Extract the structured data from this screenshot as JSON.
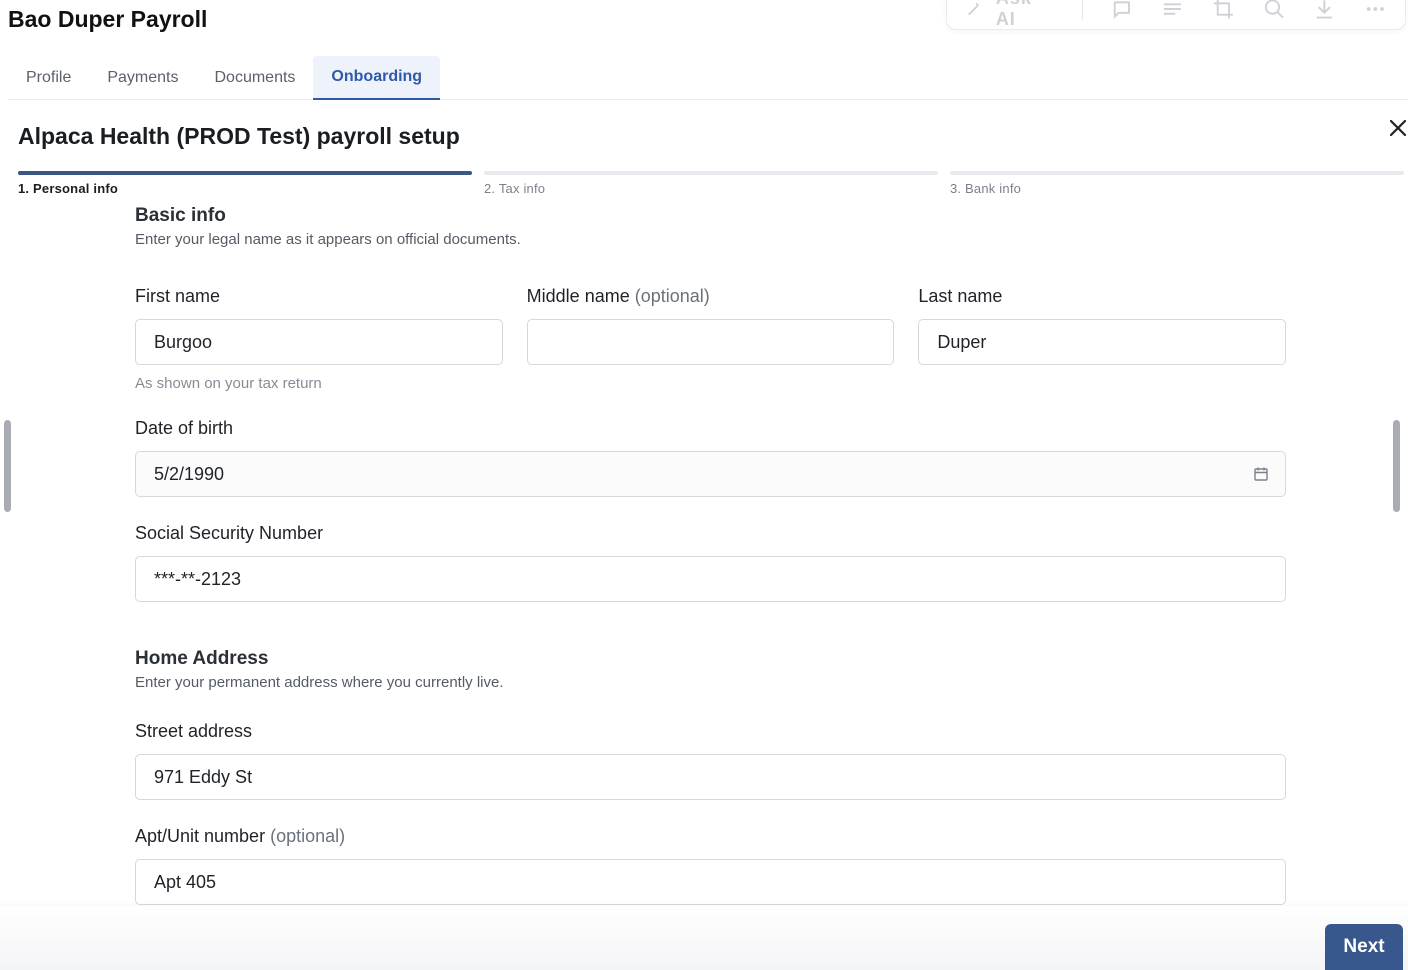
{
  "app": {
    "title": "Bao Duper Payroll"
  },
  "toolbar": {
    "ask_label": "Ask AI",
    "icons": [
      "sparkle-icon",
      "comment-icon",
      "lines-icon",
      "crop-icon",
      "zoom-icon",
      "download-icon",
      "more-icon"
    ]
  },
  "tabs": [
    {
      "label": "Profile",
      "active": false
    },
    {
      "label": "Payments",
      "active": false
    },
    {
      "label": "Documents",
      "active": false
    },
    {
      "label": "Onboarding",
      "active": true
    }
  ],
  "setup": {
    "title": "Alpaca Health (PROD Test) payroll setup",
    "steps": [
      {
        "label": "1. Personal info",
        "active": true
      },
      {
        "label": "2. Tax info",
        "active": false
      },
      {
        "label": "3. Bank info",
        "active": false
      }
    ]
  },
  "basic_info": {
    "title": "Basic info",
    "description": "Enter your legal name as it appears on official documents.",
    "first_name": {
      "label": "First name",
      "value": "Burgoo",
      "hint": "As shown on your tax return"
    },
    "middle_name": {
      "label": "Middle name",
      "optional": "(optional)",
      "value": ""
    },
    "last_name": {
      "label": "Last name",
      "value": "Duper"
    },
    "dob": {
      "label": "Date of birth",
      "value": "5/2/1990"
    },
    "ssn": {
      "label": "Social Security Number",
      "value": "***-**-2123"
    }
  },
  "home_address": {
    "title": "Home Address",
    "description": "Enter your permanent address where you currently live.",
    "street": {
      "label": "Street address",
      "value": "971 Eddy St"
    },
    "apt": {
      "label": "Apt/Unit number",
      "optional": "(optional)",
      "value": "Apt 405"
    }
  },
  "footer": {
    "next_label": "Next"
  },
  "colors": {
    "accent": "#2e5aa8",
    "button": "#38578d",
    "step_active": "#3b5584"
  }
}
